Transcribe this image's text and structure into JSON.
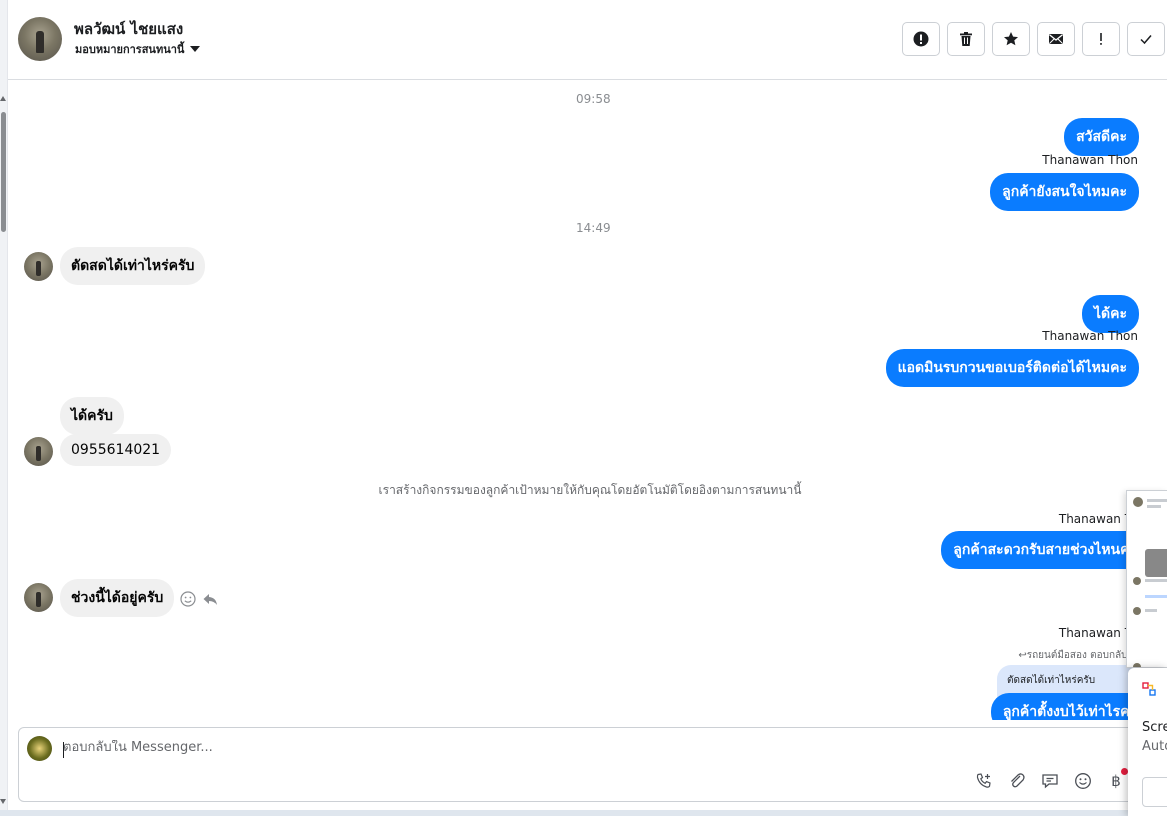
{
  "header": {
    "contact_name": "พลวัฒน์ ไชยแสง",
    "assign_label": "มอบหมายการสนทนานี้",
    "toolbar": [
      {
        "name": "spam-alert-button",
        "icon": "alert-circle-icon"
      },
      {
        "name": "delete-button",
        "icon": "trash-icon"
      },
      {
        "name": "star-button",
        "icon": "star-icon"
      },
      {
        "name": "mark-unread-button",
        "icon": "envelope-icon"
      },
      {
        "name": "follow-up-button",
        "icon": "exclamation-icon"
      },
      {
        "name": "mark-done-button",
        "icon": "check-icon"
      }
    ]
  },
  "chat": {
    "timestamp_1": "09:58",
    "timestamp_2": "14:49",
    "out_1": "สวัสดีคะ",
    "sender_1": "Thanawan Thon",
    "out_2": "ลูกค้ายังสนใจไหมคะ",
    "in_1": "ตัดสดได้เท่าไหร่ครับ",
    "out_3": "ได้คะ",
    "sender_2": "Thanawan Thon",
    "out_4": "แอดมินรบกวนขอเบอร์ติดต่อได้ไหมคะ",
    "in_2": "ได้ครับ",
    "in_3": "0955614021",
    "system_msg": "เราสร้างกิจกรรมของลูกค้าเป้าหมายให้กับคุณโดยอัตโนมัติโดยอิงตามการสนทนานี้",
    "sender_3": "Thanawan Tho",
    "out_5": "ลูกค้าสะดวกรับสายช่วงไหนคะ",
    "in_4": "ช่วงนี้ได้อยู่ครับ",
    "sender_4": "Thanawan Tho",
    "reply_note": "รถยนต์มือสอง ตอบกลับ พลวั",
    "quoted_text": "ตัดสดได้เท่าไหร่ครับ",
    "out_6": "ลูกค้าตั้งงบไว้เท่าไรคะ"
  },
  "composer": {
    "placeholder": "ตอบกลับใน Messenger...",
    "tools": [
      "call-add-icon",
      "paperclip-icon",
      "saved-reply-icon",
      "emoji-icon",
      "baht-icon"
    ]
  },
  "notification": {
    "title": "Scre",
    "subtitle": "Auto"
  }
}
